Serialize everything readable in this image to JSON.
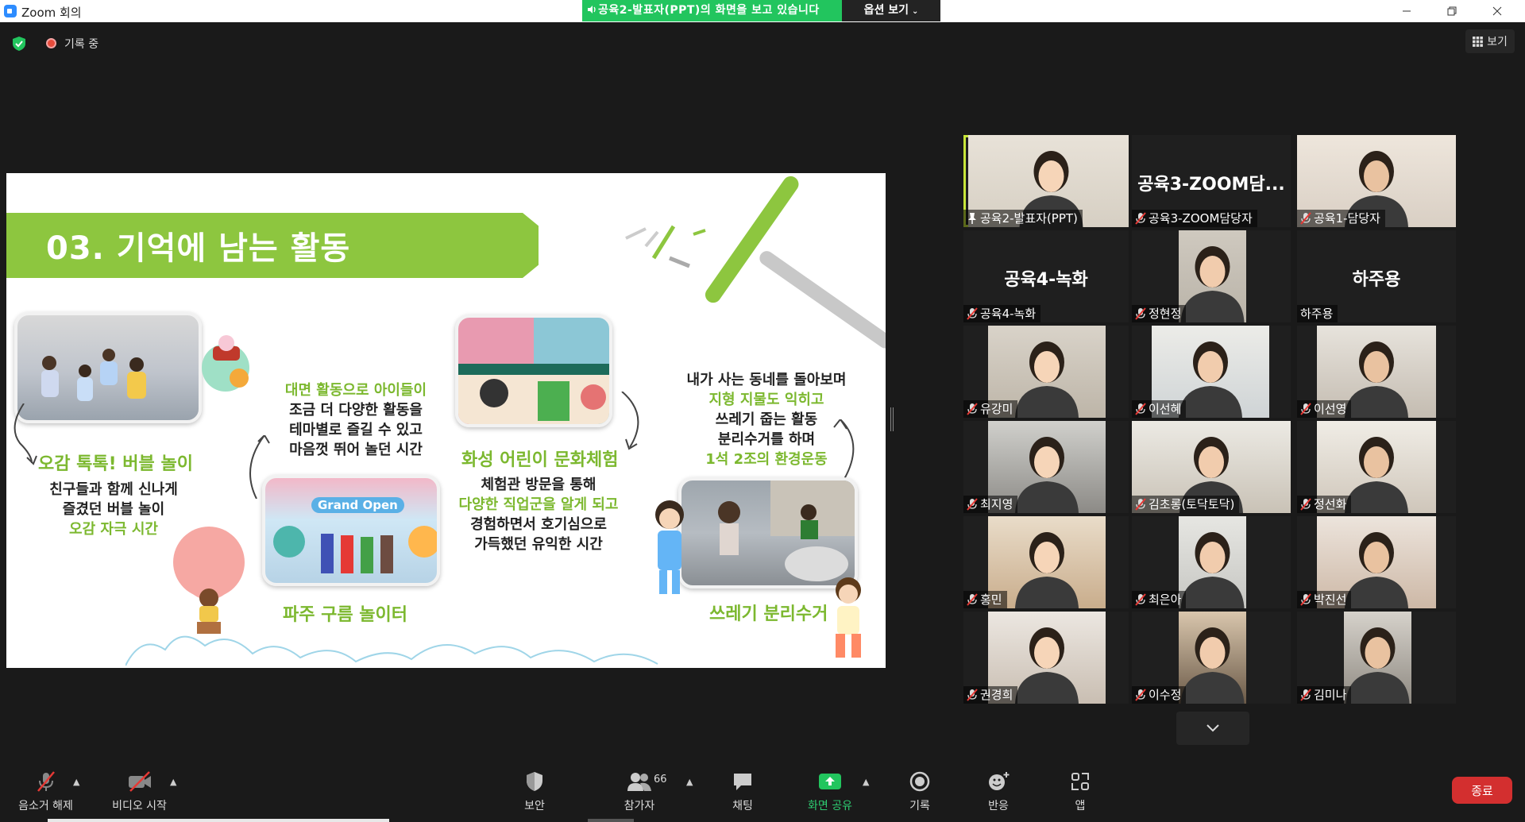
{
  "window": {
    "title": "Zoom 회의",
    "share_banner": "공육2-발표자(PPT)의 화면을 보고 있습니다",
    "view_options": "옵션 보기"
  },
  "meeting": {
    "recording_label": "기록 중",
    "view_label": "보기"
  },
  "slide": {
    "title": "03. 기억에 남는 활동",
    "caption_bubble": "오감 톡톡! 버블 놀이",
    "text_bubble": [
      "친구들과 함께 신나게",
      "즐겼던 버블 놀이",
      "오감 자극 시간"
    ],
    "text_face": [
      "대면 활동으로 아이들이",
      "조금 더 다양한 활동을",
      "테마별로 즐길 수 있고",
      "마음껏 뛰어 놀던 시간"
    ],
    "caption_cloud": "파주 구름 놀이터",
    "grand_open": "Grand Open",
    "caption_culture": "화성 어린이 문화체험",
    "text_culture": [
      "체험관 방문을 통해",
      "다양한 직업군을 알게 되고",
      "경험하면서 호기심으로",
      "가득했던  유익한 시간"
    ],
    "text_neighborhood": [
      "내가 사는 동네를 돌아보며",
      "지형 지물도 익히고",
      "쓰레기 줍는 활동",
      "분리수거를 하며",
      "1석 2조의 환경운동"
    ],
    "caption_recycle": "쓰레기 분리수거"
  },
  "participants": [
    {
      "name": "공육2-발표자(PPT)",
      "video": true,
      "pinned": true
    },
    {
      "name": "공육3-ZOOM담당자",
      "video": false,
      "big": "공육3-ZOOM담..."
    },
    {
      "name": "공육1-담당자",
      "video": true
    },
    {
      "name": "공육4-녹화",
      "video": false,
      "big": "공육4-녹화"
    },
    {
      "name": "정현정",
      "video": true
    },
    {
      "name": "하주용",
      "video": false,
      "big": "하주용"
    },
    {
      "name": "유강미",
      "video": true
    },
    {
      "name": "이선혜",
      "video": true
    },
    {
      "name": "이선영",
      "video": true
    },
    {
      "name": "최지영",
      "video": true
    },
    {
      "name": "김초롱(토닥토닥)",
      "video": true
    },
    {
      "name": "정선화",
      "video": true
    },
    {
      "name": "홍민",
      "video": true
    },
    {
      "name": "최은아",
      "video": true
    },
    {
      "name": "박진선",
      "video": true
    },
    {
      "name": "권경희",
      "video": true
    },
    {
      "name": "이수정",
      "video": true
    },
    {
      "name": "김미나",
      "video": true
    }
  ],
  "toolbar": {
    "mute": "음소거 해제",
    "video": "비디오 시작",
    "security": "보안",
    "participants": "참가자",
    "participants_count": "66",
    "chat": "채팅",
    "share": "화면 공유",
    "record": "기록",
    "reactions": "반응",
    "apps": "앱",
    "end": "종료"
  },
  "colors": {
    "share_green": "#22c55e",
    "slide_green": "#8dc63f",
    "end_red": "#d32f2f",
    "speaker_highlight": "#c8e63a"
  }
}
